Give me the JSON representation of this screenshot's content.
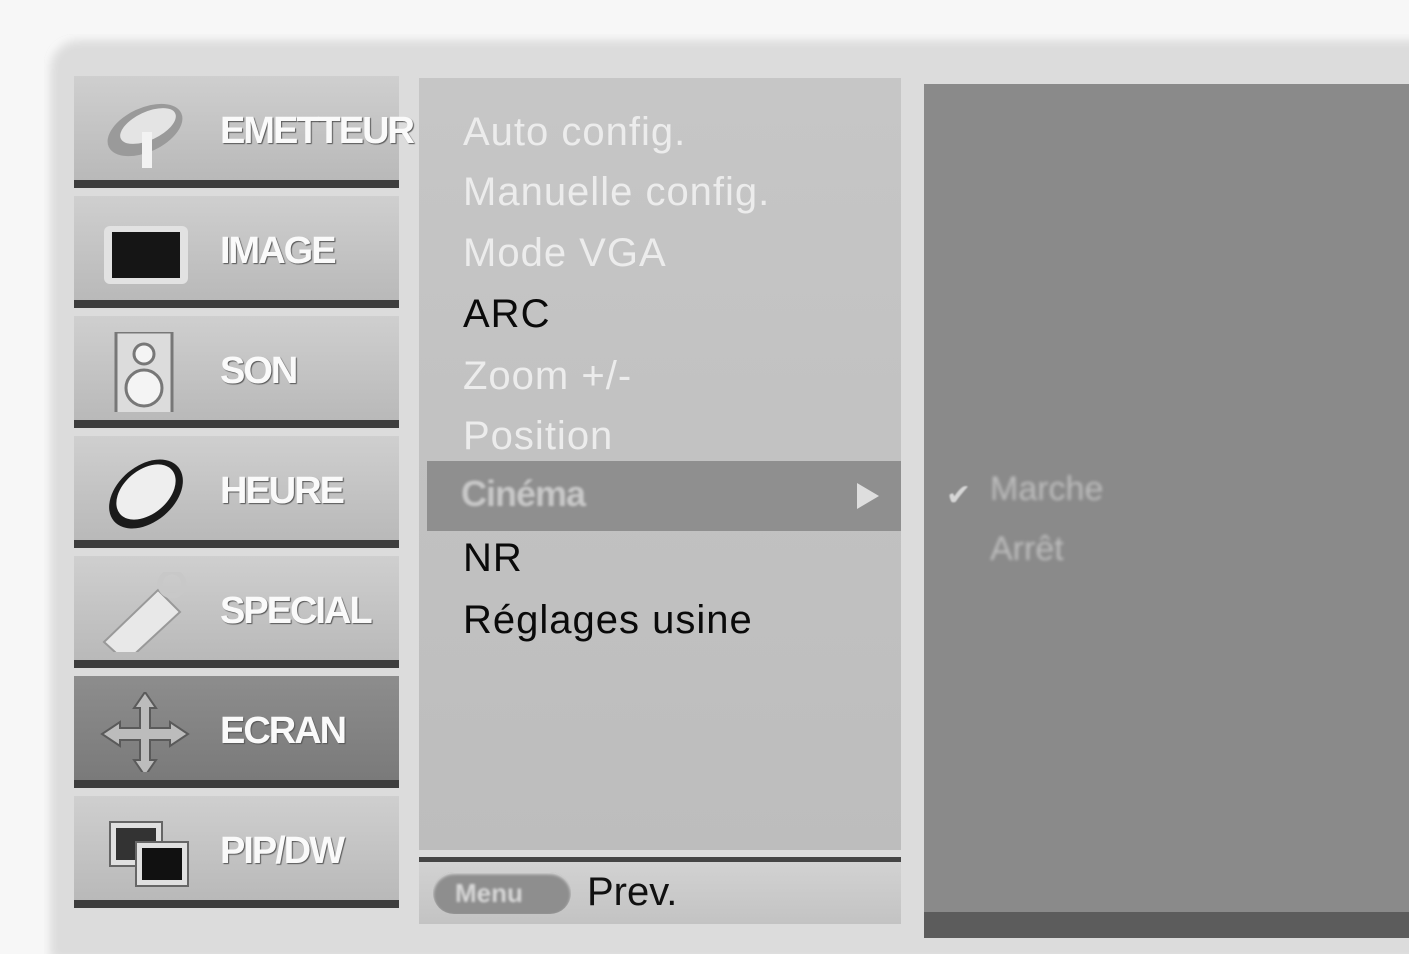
{
  "sidebar": {
    "items": [
      {
        "label": "EMETTEUR",
        "icon": "satellite-dish-icon",
        "active": false
      },
      {
        "label": "IMAGE",
        "icon": "tv-screen-icon",
        "active": false
      },
      {
        "label": "SON",
        "icon": "speaker-icon",
        "active": false
      },
      {
        "label": "HEURE",
        "icon": "clock-icon",
        "active": false
      },
      {
        "label": "SPECIAL",
        "icon": "tag-icon",
        "active": false
      },
      {
        "label": "ECRAN",
        "icon": "move-arrows-icon",
        "active": true
      },
      {
        "label": "PIP/DW",
        "icon": "pip-windows-icon",
        "active": false
      }
    ]
  },
  "submenu": {
    "items": [
      {
        "label": "Auto config.",
        "enabled": false
      },
      {
        "label": "Manuelle config.",
        "enabled": false
      },
      {
        "label": "Mode VGA",
        "enabled": false
      },
      {
        "label": "ARC",
        "enabled": true
      },
      {
        "label": "Zoom +/-",
        "enabled": false
      },
      {
        "label": "Position",
        "enabled": false
      },
      {
        "label": "Cinéma",
        "enabled": true,
        "selected": true
      },
      {
        "label": "NR",
        "enabled": true
      },
      {
        "label": "Réglages usine",
        "enabled": true
      }
    ]
  },
  "options": {
    "items": [
      "Marche",
      "Arrêt"
    ],
    "checked_index": 0,
    "check_glyph": "✔"
  },
  "footer": {
    "menu_button": "Menu",
    "prev_label": "Prev."
  },
  "colors": {
    "sidebar_active": "#7a7a7a",
    "selection_bar": "#8f8f8f",
    "right_panel": "#8a8a8a"
  }
}
